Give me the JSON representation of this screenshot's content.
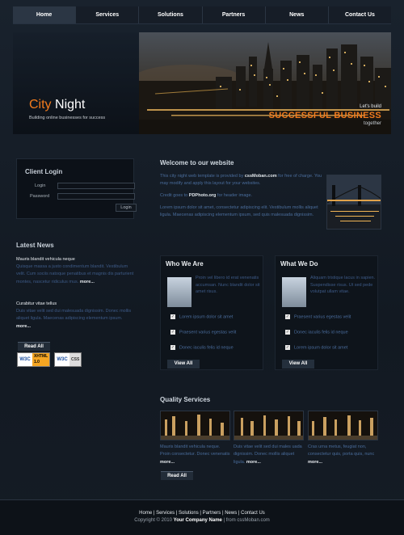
{
  "nav": [
    "Home",
    "Services",
    "Solutions",
    "Partners",
    "News",
    "Contact Us"
  ],
  "header": {
    "logo_city": "City",
    "logo_night": " Night",
    "tagline": "Building online businesses for success",
    "slogan_line1": "Let's build",
    "slogan_line2": "SUCCESSFUL BUSINESS",
    "slogan_line3": "together"
  },
  "login": {
    "title": "Client Login",
    "username_label": "Login",
    "password_label": "Password",
    "button": "Login"
  },
  "news": {
    "title": "Latest News",
    "items": [
      {
        "title": "Mauris blandit vehicula neque",
        "body": "Quisque massa a justo condimentum blandit. Vestibulum velit. Cum sociis natoque penatibus et magnis dis parturient montes, nascetur ridiculus mus.",
        "more": "more..."
      },
      {
        "title": "Curabitur vitae tellus",
        "body": "Duis vitae velit sed dui malesuada dignissim. Donec mollis aliquet ligula. Maecenas adipiscing elementum ipsum.",
        "more": "more..."
      }
    ],
    "read_all": "Read All",
    "badges": [
      {
        "w3c": "W3C",
        "label1": "XHTML",
        "label2": "1.0"
      },
      {
        "w3c": "W3C",
        "label1": "CSS"
      }
    ]
  },
  "welcome": {
    "title": "Welcome to our website",
    "p1_a": "This city night web template is provided by ",
    "p1_b": "cssMoban.com",
    "p1_c": " for free of charge. You may modify and apply this layout for your websites.",
    "p2_a": "Credit goes to ",
    "p2_b": "PDPhoto.org",
    "p2_c": " for header image.",
    "p3": "Lorem ipsum dolor sit amet, consectetur adipiscing elit. Vestibulum mollis aliquet ligula. Maecenas adipiscing elementum ipsum, sed quis malesuada dignissim."
  },
  "who": {
    "title": "Who We Are",
    "text": "Proin vel libero id erat venenatis accumsan. Nunc blandit dolor sit amet risus.",
    "items": [
      "Lorem ipsum dolor sit amet",
      "Praesent varius egestas velit",
      "Donec iaculis felis id neque"
    ],
    "view_all": "View All"
  },
  "what": {
    "title": "What We Do",
    "text": "Aliquam tristique lacus in sapien. Suspendisse risus. Ut sed pede volutpat ullam vitae.",
    "items": [
      "Praesent varius egestas velit",
      "Donec iaculis felis id neque",
      "Lorem ipsum dolor sit amet"
    ],
    "view_all": "View All"
  },
  "quality": {
    "title": "Quality Services",
    "cols": [
      {
        "text": "Mauris blandit vehicula neque. Proin consectetur. Donec venenatis ",
        "more": "more..."
      },
      {
        "text": "Duis vitae velit sed dui males uada dignissim. Donec mollis aliquet ligula. ",
        "more": "more..."
      },
      {
        "text": "Cras urna metus, feugiat non, consectetur quis, porta quis, nunc ",
        "more": "more..."
      }
    ],
    "read_all": "Read All"
  },
  "footer": {
    "links": [
      "Home",
      "Services",
      "Solutions",
      "Partners",
      "News",
      "Contact Us"
    ],
    "copy_a": "Copyright © 2010 ",
    "company": "Your Company Name",
    "copy_b": " | from cssMoban.com"
  }
}
